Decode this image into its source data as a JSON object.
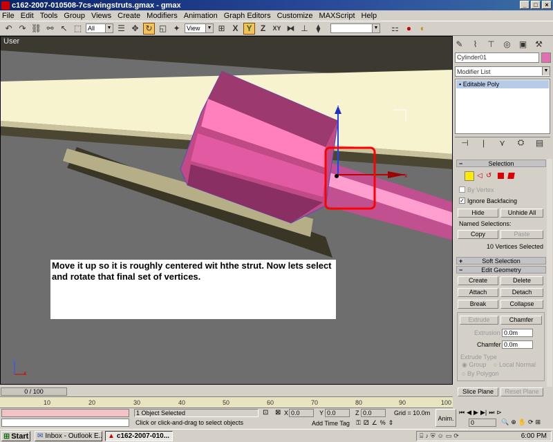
{
  "window": {
    "title": "c162-2007-010508-7cs-wingstruts.gmax - gmax",
    "min": "_",
    "max": "□",
    "close": "×"
  },
  "menu": [
    "File",
    "Edit",
    "Tools",
    "Group",
    "Views",
    "Create",
    "Modifiers",
    "Animation",
    "Graph Editors",
    "Customize",
    "MAXScript",
    "Help"
  ],
  "toolbar": {
    "selection_filter": "All",
    "ref_coord": "View"
  },
  "viewport": {
    "label": "User",
    "caption": "Move it up so it is roughly centered wit hthe strut.  Now lets select and rotate that final set of vertices.",
    "gizmo": {
      "z_axis": "z",
      "x_axis": "x"
    },
    "axis_tripod": {
      "z": "z",
      "x": "x"
    }
  },
  "command_panel": {
    "object_name": "Cylinder01",
    "object_color": "#e070b0",
    "modifier_list": "Modifier List",
    "stack_item": "Editable Poly",
    "selection": {
      "title": "Selection",
      "by_vertex": "By Vertex",
      "ignore_backfacing": "Ignore Backfacing",
      "hide": "Hide",
      "unhide_all": "Unhide All",
      "named_selections": "Named Selections:",
      "copy": "Copy",
      "paste": "Paste",
      "status": "10 Vertices Selected"
    },
    "soft_selection": "Soft Selection",
    "edit_geometry": {
      "title": "Edit Geometry",
      "create": "Create",
      "delete": "Delete",
      "attach": "Attach",
      "detach": "Detach",
      "break": "Break",
      "collapse": "Collapse",
      "extrude": "Extrude",
      "chamfer_btn": "Chamfer",
      "extrusion_label": "Extrusion",
      "extrusion_value": "0.0m",
      "chamfer_label": "Chamfer",
      "chamfer_value": "0.0m",
      "extrude_type": "Extrude Type",
      "group": "Group",
      "local_normal": "Local Normal",
      "by_polygon": "By Polygon",
      "slice_plane": "Slice Plane",
      "reset_plane": "Reset Plane"
    }
  },
  "timeline": {
    "slider": "0 / 100",
    "ticks": [
      "10",
      "20",
      "30",
      "40",
      "50",
      "60",
      "70",
      "80",
      "90",
      "100"
    ]
  },
  "status": {
    "selected": "1 Object Selected",
    "prompt": "Click or click-and-drag to select objects",
    "x_label": "X",
    "x": "0.0",
    "y_label": "Y",
    "y": "0.0",
    "z_label": "Z",
    "z": "0.0",
    "grid": "Grid = 10.0m",
    "add_time_tag": "Add Time Tag",
    "anim": "Anim.",
    "frame": "0"
  },
  "taskbar": {
    "start": "Start",
    "tasks": [
      "Inbox - Outlook E...",
      "c162-2007-010..."
    ],
    "time": "6:00 PM"
  }
}
